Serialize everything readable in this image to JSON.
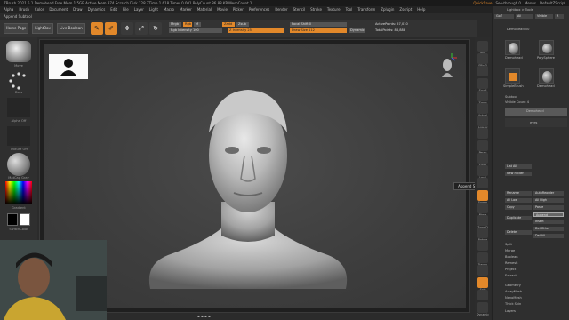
{
  "titlebar": {
    "text": "ZBrush 2021.5.1   Demohead   Free Mem 1.5GB  Active Mem 874  Scratch Disk 128  ZTime 1.618 Timer 0.001  PolyCount 86.88 KP  MeshCount 1",
    "quicksave": "QuickSave",
    "see_through": "See-through 0",
    "menus_label": "Menus",
    "script_label": "DefaultZScript"
  },
  "menubar": [
    "Alpha",
    "Brush",
    "Color",
    "Document",
    "Draw",
    "Dynamics",
    "Edit",
    "File",
    "Layer",
    "Light",
    "Macro",
    "Marker",
    "Material",
    "Movie",
    "Picker",
    "Preferences",
    "Render",
    "Stencil",
    "Stroke",
    "Texture",
    "Tool",
    "Transform",
    "Zplugin",
    "Zscript",
    "Help"
  ],
  "subtool_header": "Append Subtool",
  "shelf": {
    "home": "Home Page",
    "lightbox": "LightBox",
    "live_boolean": "Live Boolean",
    "tools": [
      {
        "icon": "edit-icon",
        "label": "Edit"
      },
      {
        "icon": "draw-icon",
        "label": "Draw"
      },
      {
        "icon": "move-icon",
        "label": "Move"
      },
      {
        "icon": "scale-icon",
        "label": "Scale"
      },
      {
        "icon": "rotate-icon",
        "label": "Rotate"
      }
    ],
    "mrgb": "Mrgb",
    "rgb": "Rgb",
    "m": "M",
    "zadd": "Zadd",
    "zsub": "Zsub",
    "rgb_intensity": "Rgb Intensity 100",
    "z_intensity": "Z Intensity 25",
    "focal_shift": "Focal Shift 0",
    "draw_size": "Draw Size 112",
    "dynamic": "Dynamic",
    "active_points": "ActivePoints: 57,010",
    "total_points": "TotalPoints: 86,888"
  },
  "left": {
    "brush_label": "Move",
    "stroke_label": "Dots",
    "alpha_label": "Alpha Off",
    "texture_label": "Texture Off",
    "material_label": "MatCap Gray",
    "gradient_label": "Gradient",
    "switch_label": "SwitchColor"
  },
  "rstrip": [
    "Bpr",
    "SPix 3",
    "",
    "Scroll",
    "Zoom",
    "Actual",
    "AAHalf",
    "",
    "Persp",
    "Floor",
    "Local",
    "",
    "Frame",
    "Move",
    "ZoomD",
    "Rotate",
    "",
    "Transp",
    "",
    "Solo",
    "",
    "Dynamic"
  ],
  "rpanel": {
    "top": [
      "Lightbox > Tools",
      "Demohead  50"
    ],
    "goz": "GoZ",
    "all": "All",
    "visible": "Visible",
    "rvalue": "R",
    "thumbs": [
      "Demohead",
      "PolySphere",
      "SimpleBrush",
      "Demohead"
    ],
    "subtool": "Subtool",
    "visible_count": "Visible Count 4",
    "list": [
      "Demohead",
      "eyes"
    ],
    "list_all": "List All",
    "new_folder": "New Folder",
    "rename": "Rename",
    "autoreorder": "AutoReorder",
    "all_low": "All Low",
    "all_high": "All High",
    "copy": "Copy",
    "paste": "Paste",
    "append": "Append",
    "duplicate": "Duplicate",
    "insert": "Insert",
    "del_other": "Del Other",
    "delete": "Delete",
    "del_all": "Del All",
    "split": "Split",
    "merge": "Merge",
    "boolean": "Boolean",
    "remesh": "Remesh",
    "project": "Project",
    "extract": "Extract",
    "sections": [
      "Geometry",
      "ArrayMesh",
      "NanoMesh",
      "Thick Skin",
      "Layers"
    ]
  },
  "tooltip": "Append Subtool",
  "colors": {
    "accent": "#e2882a",
    "bg": "#2b2b2b",
    "canvas": "#3e3e3e"
  }
}
